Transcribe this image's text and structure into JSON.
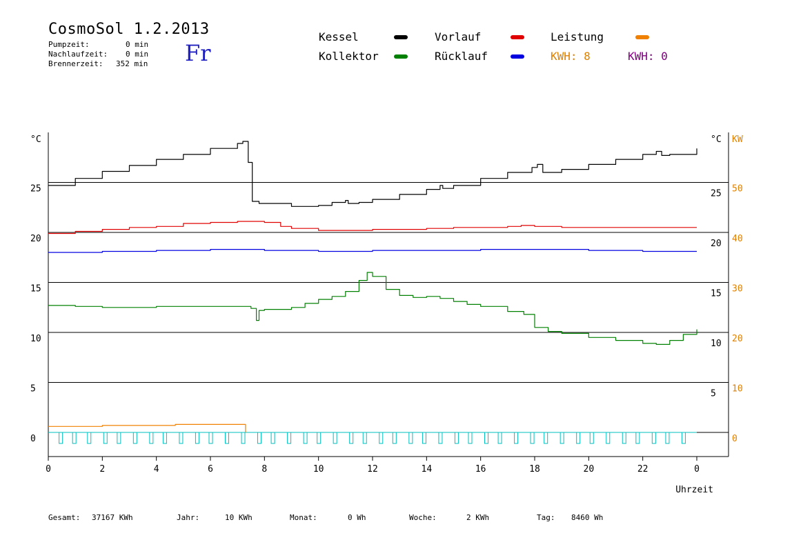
{
  "header": {
    "title": "CosmoSol 1.2.2013",
    "day": "Fr",
    "stats": [
      {
        "label": "Pumpzeit:",
        "value": "0 min"
      },
      {
        "label": "Nachlaufzeit:",
        "value": "0 min"
      },
      {
        "label": "Brennerzeit:",
        "value": "352 min"
      }
    ]
  },
  "legend": {
    "kessel": "Kessel",
    "kollektor": "Kollektor",
    "vorlauf": "Vorlauf",
    "ruecklauf": "Rücklauf",
    "leistung": "Leistung",
    "kwh1": "KWH: 8",
    "kwh2": "KWH: 0"
  },
  "colors": {
    "kessel": "#000000",
    "kollektor": "#008000",
    "vorlauf": "#e00000",
    "ruecklauf": "#0000e0",
    "leistung": "#f08000",
    "kwh2": "#800080",
    "pump": "#00c0c0"
  },
  "footer": {
    "gesamt_label": "Gesamt:",
    "gesamt_value": "37167 KWh",
    "jahr_label": "Jahr:",
    "jahr_value": "10 KWh",
    "monat_label": "Monat:",
    "monat_value": "0 Wh",
    "woche_label": "Woche:",
    "woche_value": "2 KWh",
    "tag_label": "Tag:",
    "tag_value": "8460 Wh"
  },
  "chart_data": {
    "type": "line",
    "xlabel": "Uhrzeit",
    "y_left_unit": "°C",
    "y_right_unit": "°C",
    "y_power_unit": "KW",
    "x_range": [
      0,
      24
    ],
    "x_ticks": [
      "0",
      "2",
      "4",
      "6",
      "8",
      "10",
      "12",
      "14",
      "16",
      "18",
      "20",
      "22",
      "0"
    ],
    "ylim": [
      0,
      30
    ],
    "y_left_ticks": [
      "0",
      "5",
      "10",
      "15",
      "20",
      "25"
    ],
    "y_right_ticks": [
      "5",
      "10",
      "15",
      "20",
      "25"
    ],
    "y_power_ticks": [
      "0",
      "10",
      "20",
      "30",
      "40",
      "50"
    ],
    "grid": true,
    "series": [
      {
        "name": "Kessel",
        "color": "#000000",
        "points": [
          [
            0,
            24.7
          ],
          [
            1,
            25.4
          ],
          [
            2,
            26.1
          ],
          [
            3,
            26.7
          ],
          [
            4,
            27.3
          ],
          [
            5,
            27.8
          ],
          [
            6,
            28.4
          ],
          [
            7,
            28.9
          ],
          [
            7.2,
            29.1
          ],
          [
            7.4,
            27.0
          ],
          [
            7.55,
            23.1
          ],
          [
            7.8,
            22.9
          ],
          [
            8.5,
            22.9
          ],
          [
            9,
            22.6
          ],
          [
            10,
            22.7
          ],
          [
            10.5,
            23.0
          ],
          [
            11,
            23.2
          ],
          [
            11.1,
            22.9
          ],
          [
            11.5,
            23.0
          ],
          [
            12,
            23.3
          ],
          [
            13,
            23.8
          ],
          [
            14,
            24.3
          ],
          [
            14.5,
            24.7
          ],
          [
            14.6,
            24.4
          ],
          [
            15,
            24.7
          ],
          [
            16,
            25.4
          ],
          [
            17,
            26.0
          ],
          [
            17.9,
            26.5
          ],
          [
            18.1,
            26.8
          ],
          [
            18.3,
            26.0
          ],
          [
            19,
            26.3
          ],
          [
            20,
            26.8
          ],
          [
            21,
            27.3
          ],
          [
            22,
            27.8
          ],
          [
            22.5,
            28.1
          ],
          [
            22.7,
            27.7
          ],
          [
            23,
            27.8
          ],
          [
            24,
            28.4
          ]
        ]
      },
      {
        "name": "Vorlauf",
        "color": "#e00000",
        "points": [
          [
            0,
            19.9
          ],
          [
            1,
            20.1
          ],
          [
            2,
            20.3
          ],
          [
            3,
            20.5
          ],
          [
            4,
            20.6
          ],
          [
            5,
            20.9
          ],
          [
            6,
            21.0
          ],
          [
            7,
            21.1
          ],
          [
            8,
            21.0
          ],
          [
            8.6,
            20.6
          ],
          [
            9,
            20.4
          ],
          [
            10,
            20.2
          ],
          [
            11,
            20.2
          ],
          [
            12,
            20.3
          ],
          [
            13,
            20.3
          ],
          [
            14,
            20.4
          ],
          [
            15,
            20.5
          ],
          [
            16,
            20.5
          ],
          [
            17,
            20.6
          ],
          [
            17.5,
            20.7
          ],
          [
            18,
            20.6
          ],
          [
            19,
            20.5
          ],
          [
            20,
            20.5
          ],
          [
            21,
            20.5
          ],
          [
            22,
            20.5
          ],
          [
            24,
            20.5
          ]
        ]
      },
      {
        "name": "Rücklauf",
        "color": "#0000e0",
        "points": [
          [
            0,
            18.0
          ],
          [
            2,
            18.1
          ],
          [
            4,
            18.2
          ],
          [
            6,
            18.3
          ],
          [
            8,
            18.2
          ],
          [
            10,
            18.1
          ],
          [
            12,
            18.2
          ],
          [
            14,
            18.2
          ],
          [
            16,
            18.3
          ],
          [
            18,
            18.3
          ],
          [
            20,
            18.2
          ],
          [
            22,
            18.1
          ],
          [
            24,
            18.1
          ]
        ]
      },
      {
        "name": "Kollektor",
        "color": "#008000",
        "points": [
          [
            0,
            12.7
          ],
          [
            1,
            12.6
          ],
          [
            2,
            12.5
          ],
          [
            3,
            12.5
          ],
          [
            4,
            12.6
          ],
          [
            5,
            12.6
          ],
          [
            6,
            12.6
          ],
          [
            7,
            12.6
          ],
          [
            7.5,
            12.4
          ],
          [
            7.7,
            11.2
          ],
          [
            7.8,
            12.2
          ],
          [
            8,
            12.3
          ],
          [
            9,
            12.5
          ],
          [
            9.5,
            12.9
          ],
          [
            10,
            13.3
          ],
          [
            10.5,
            13.6
          ],
          [
            11,
            14.1
          ],
          [
            11.5,
            15.2
          ],
          [
            11.8,
            16.0
          ],
          [
            12,
            15.6
          ],
          [
            12.5,
            14.3
          ],
          [
            13,
            13.7
          ],
          [
            13.5,
            13.5
          ],
          [
            14,
            13.6
          ],
          [
            14.5,
            13.4
          ],
          [
            15,
            13.1
          ],
          [
            15.5,
            12.8
          ],
          [
            16,
            12.6
          ],
          [
            17,
            12.1
          ],
          [
            17.6,
            11.8
          ],
          [
            18,
            10.5
          ],
          [
            18.5,
            10.1
          ],
          [
            19,
            9.9
          ],
          [
            20,
            9.5
          ],
          [
            21,
            9.2
          ],
          [
            22,
            8.9
          ],
          [
            22.5,
            8.8
          ],
          [
            23,
            9.2
          ],
          [
            23.5,
            9.8
          ],
          [
            24,
            10.3
          ]
        ]
      },
      {
        "name": "Leistung",
        "color": "#f08000",
        "points": [
          [
            0,
            0.6
          ],
          [
            2,
            0.6
          ],
          [
            2,
            0.7
          ],
          [
            4.7,
            0.8
          ],
          [
            7.3,
            0.8
          ],
          [
            7.3,
            0
          ]
        ]
      }
    ],
    "pump_cycles_hours": [
      0.45,
      0.95,
      1.5,
      2.1,
      2.6,
      3.2,
      3.8,
      4.3,
      4.9,
      5.5,
      6.0,
      6.6,
      7.2,
      7.8,
      8.3,
      8.9,
      9.5,
      10.0,
      10.6,
      11.2,
      11.7,
      12.3,
      12.8,
      13.4,
      13.9,
      14.5,
      15.1,
      15.6,
      16.2,
      16.7,
      17.3,
      17.9,
      18.4,
      19.0,
      19.6,
      20.1,
      20.7,
      21.3,
      21.8,
      22.4,
      22.9,
      23.5
    ]
  }
}
